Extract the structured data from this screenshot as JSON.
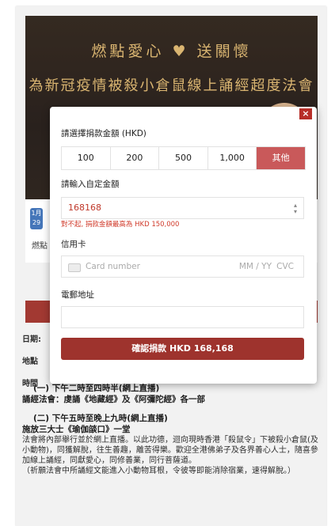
{
  "banner": {
    "line1_a": "燃點愛心",
    "line1_b": "送關懷",
    "line2": "為新冠疫情被殺小倉鼠線上誦經超度法會"
  },
  "side": {
    "date_top": "1月",
    "date_bottom": "29",
    "text": "燃點"
  },
  "info_labels": [
    "日期:",
    "地點",
    "時間"
  ],
  "schedule": [
    {
      "title": "(一) 下午二時至四時半(網上直播)",
      "detail": "誦經法會：虔誦《地藏經》及《阿彌陀經》各一部"
    },
    {
      "title": "(二) 下午五時至晚上九時(網上直播)",
      "detail": "施放三大士《瑜伽燄口》一堂"
    }
  ],
  "description": "法會將內部舉行並於網上直播。以此功德，迴向現時香港「殺鼠令」下被殺小倉鼠(及小動物)，同獲解脫，往生善趣，離苦得樂。歡迎全港佛弟子及各界善心人士，隨喜參加線上誦經，同獻愛心，同修善業，同行菩薩道。",
  "description2": "（祈願法會中所誦經文能進入小動物耳根，令彼等即能消除宿業，速得解脫。）",
  "modal": {
    "close_label": "×",
    "amount_label": "請選擇捐款金額 (HKD)",
    "amounts": [
      "100",
      "200",
      "500",
      "1,000",
      "其他"
    ],
    "selected": "其他",
    "custom_label": "請輸入自定金額",
    "custom_value": "168168",
    "error": "對不起, 捐款金額最高為 HKD 150,000",
    "card_label": "信用卡",
    "card_placeholder": "Card number",
    "expiry_placeholder": "MM / YY",
    "cvc_placeholder": "CVC",
    "email_label": "電郵地址",
    "email_value": "",
    "submit_label": "確認捐款 HKD 168,168"
  },
  "colors": {
    "accent": "#9e332d",
    "selected": "#c9595a",
    "error": "#d03a2a"
  }
}
